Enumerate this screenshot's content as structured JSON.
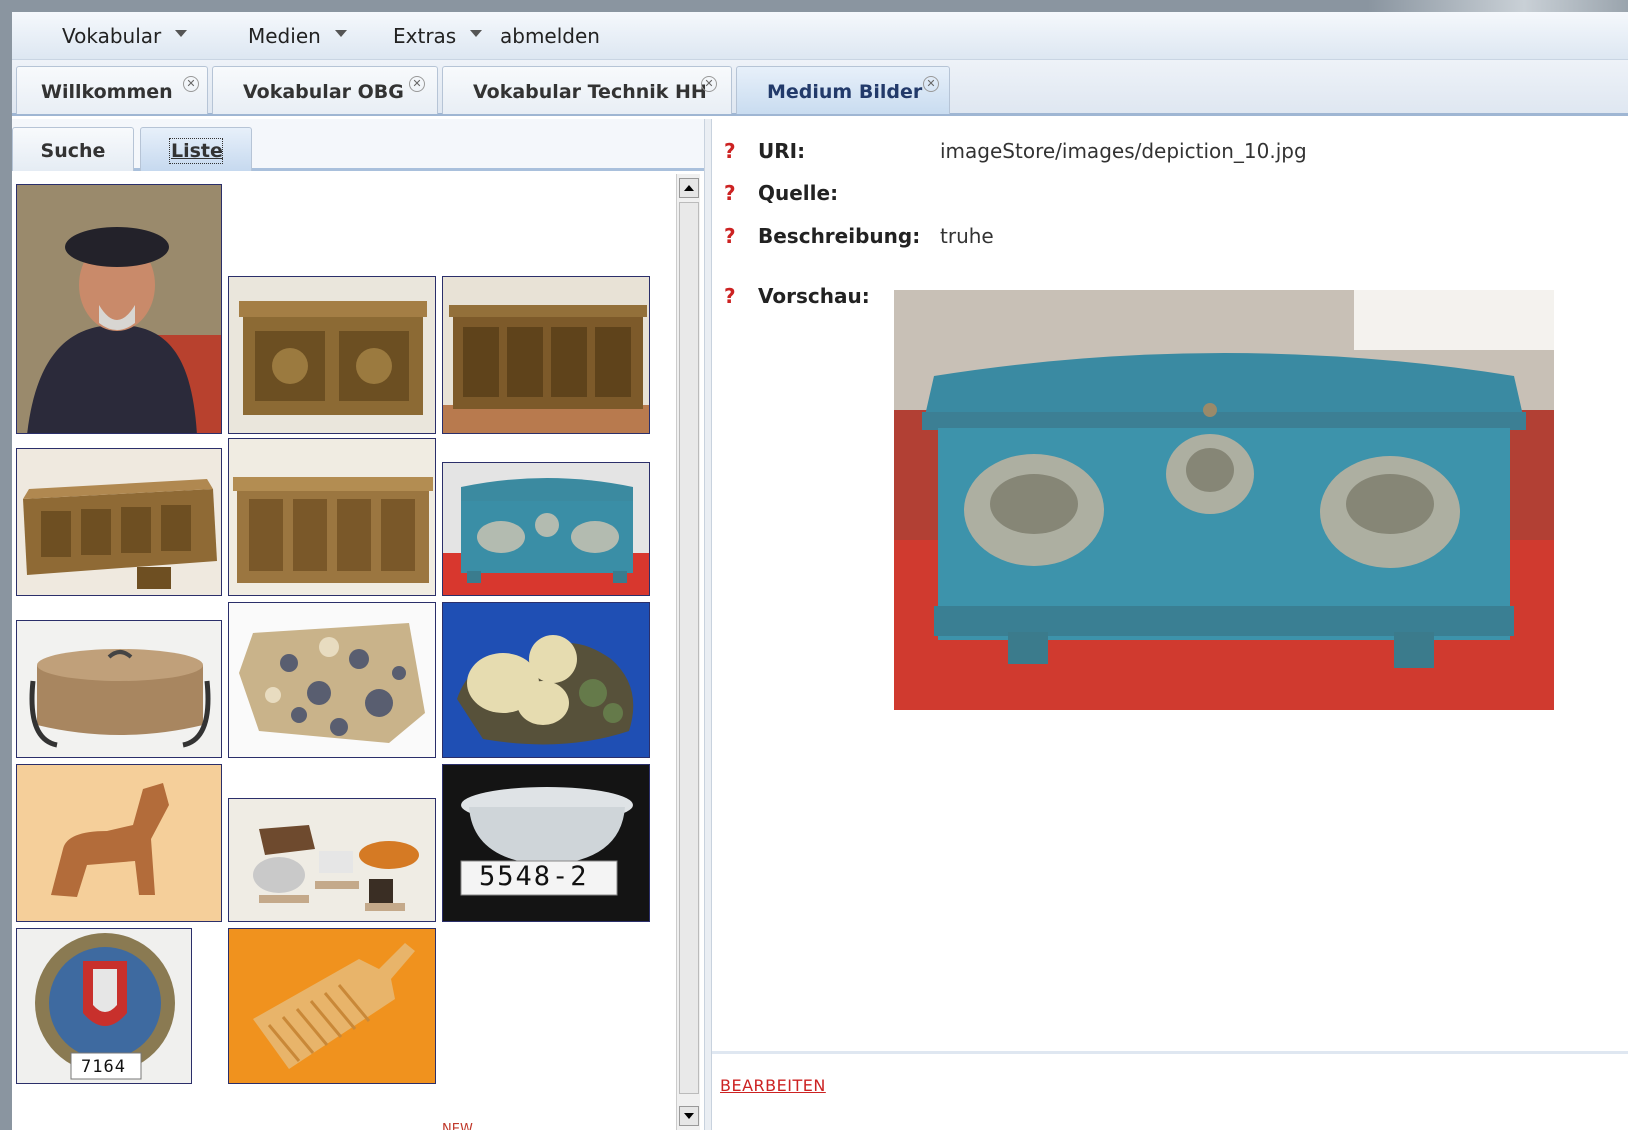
{
  "menubar": {
    "items": [
      {
        "label": "Vokabular",
        "has_dropdown": true
      },
      {
        "label": "Medien",
        "has_dropdown": true
      },
      {
        "label": "Extras",
        "has_dropdown": true
      },
      {
        "label": "abmelden",
        "has_dropdown": false
      }
    ]
  },
  "tabs": [
    {
      "label": "Willkommen",
      "active": false
    },
    {
      "label": "Vokabular OBG",
      "active": false
    },
    {
      "label": "Vokabular Technik HH",
      "active": false
    },
    {
      "label": "Medium Bilder",
      "active": true
    }
  ],
  "left_panel": {
    "subtabs": [
      {
        "label": "Suche",
        "active": false
      },
      {
        "label": "Liste",
        "active": true
      }
    ],
    "thumbnails": [
      {
        "subject": "portrait-man-beret"
      },
      {
        "subject": "carved-wooden-chest"
      },
      {
        "subject": "carved-sideboard"
      },
      {
        "subject": "carved-chest-low"
      },
      {
        "subject": "carved-chest-front"
      },
      {
        "subject": "blue-painted-chest"
      },
      {
        "subject": "bentwood-box"
      },
      {
        "subject": "granite-rock"
      },
      {
        "subject": "quartz-crystal"
      },
      {
        "subject": "wooden-horse-toy"
      },
      {
        "subject": "wooden-animal-figures"
      },
      {
        "subject": "white-bowl",
        "tag": "5548-2"
      },
      {
        "subject": "coat-of-arms-plate",
        "tag": "7164"
      },
      {
        "subject": "wooden-comb"
      }
    ],
    "new_label": "NEW"
  },
  "detail": {
    "fields": [
      {
        "label": "URI:",
        "value": "imageStore/images/depiction_10.jpg"
      },
      {
        "label": "Quelle:",
        "value": ""
      },
      {
        "label": "Beschreibung:",
        "value": "truhe"
      },
      {
        "label": "Vorschau:",
        "value": ""
      }
    ],
    "help_glyph": "?",
    "edit_label": "BEARBEITEN"
  },
  "colors": {
    "accent_red": "#cc2222",
    "tab_active": "#c9dcf0",
    "thumb_border": "#2b2f6a"
  }
}
